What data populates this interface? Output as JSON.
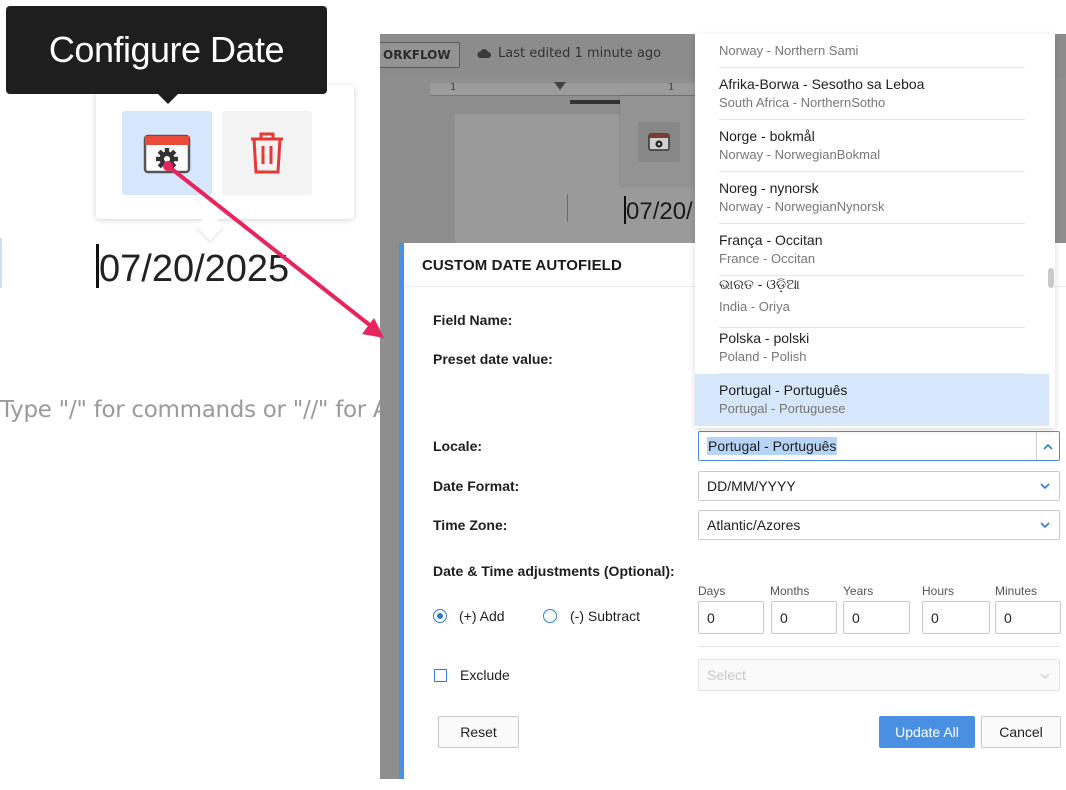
{
  "callout": {
    "tooltip": "Configure Date",
    "date_value": "07/20/2025",
    "placeholder": "Type \"/\" for commands or \"//\" for AI prompts"
  },
  "editor": {
    "workflow_label": "ORKFLOW",
    "last_edited": "Last edited 1 minute ago",
    "ruler_ticks": [
      "1",
      "1"
    ],
    "mini_date": "07/20/"
  },
  "modal": {
    "title": "CUSTOM DATE AUTOFIELD",
    "field_name_label": "Field Name:",
    "preset_label": "Preset date value:",
    "locale_label": "Locale:",
    "locale_value": "Portugal - Português",
    "date_format_label": "Date Format:",
    "date_format_value": "DD/MM/YYYY",
    "time_zone_label": "Time Zone:",
    "time_zone_value": "Atlantic/Azores",
    "adjust_label": "Date & Time adjustments (Optional):",
    "add_label": "(+) Add",
    "subtract_label": "(-) Subtract",
    "adjust_selected": "add",
    "units": [
      {
        "label": "Days",
        "value": "0"
      },
      {
        "label": "Months",
        "value": "0"
      },
      {
        "label": "Years",
        "value": "0"
      },
      {
        "label": "Hours",
        "value": "0"
      },
      {
        "label": "Minutes",
        "value": "0"
      }
    ],
    "exclude_label": "Exclude",
    "exclude_placeholder": "Select",
    "reset_label": "Reset",
    "update_label": "Update All",
    "cancel_label": "Cancel"
  },
  "locale_options": [
    {
      "name": "",
      "sub": "Norway - Northern Sami"
    },
    {
      "name": "Afrika-Borwa - Sesotho sa Leboa",
      "sub": "South Africa - NorthernSotho"
    },
    {
      "name": "Norge - bokmål",
      "sub": "Norway - NorwegianBokmal"
    },
    {
      "name": "Noreg - nynorsk",
      "sub": "Norway - NorwegianNynorsk"
    },
    {
      "name": "França - Occitan",
      "sub": "France - Occitan"
    },
    {
      "name": "ଭାରତ - ଓଡ଼ିଆ",
      "sub": "India - Oriya"
    },
    {
      "name": "Polska - polski",
      "sub": "Poland - Polish"
    },
    {
      "name": "Portugal - Português",
      "sub": "Portugal - Portuguese",
      "selected": true
    }
  ],
  "colors": {
    "accent": "#4a90e2",
    "annotation_arrow": "#e8245c",
    "tooltip_bg": "#1e1e1e",
    "delete_red": "#e53935"
  }
}
